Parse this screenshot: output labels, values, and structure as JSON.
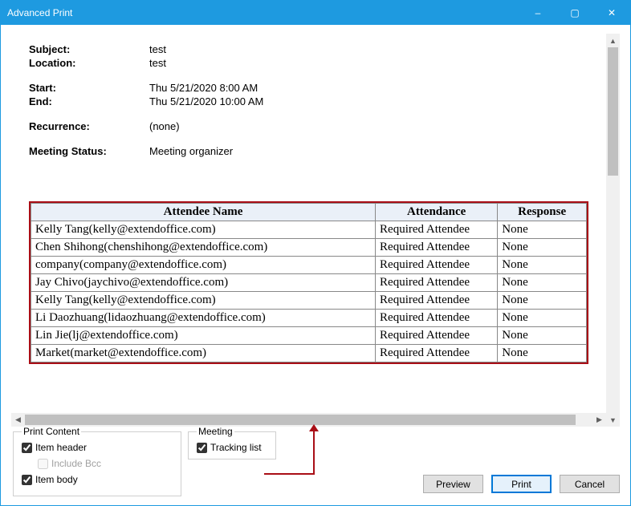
{
  "window": {
    "title": "Advanced Print"
  },
  "meta": {
    "subject_label": "Subject:",
    "subject_value": "test",
    "location_label": "Location:",
    "location_value": "test",
    "start_label": "Start:",
    "start_value": "Thu 5/21/2020 8:00 AM",
    "end_label": "End:",
    "end_value": "Thu 5/21/2020 10:00 AM",
    "recurrence_label": "Recurrence:",
    "recurrence_value": "(none)",
    "status_label": "Meeting Status:",
    "status_value": "Meeting organizer"
  },
  "tracking": {
    "col_name": "Attendee Name",
    "col_attendance": "Attendance",
    "col_response": "Response",
    "rows": [
      {
        "name": "Kelly Tang(kelly@extendoffice.com)",
        "attendance": "Required Attendee",
        "response": "None"
      },
      {
        "name": "Chen Shihong(chenshihong@extendoffice.com)",
        "attendance": "Required Attendee",
        "response": "None"
      },
      {
        "name": "company(company@extendoffice.com)",
        "attendance": "Required Attendee",
        "response": "None"
      },
      {
        "name": "Jay Chivo(jaychivo@extendoffice.com)",
        "attendance": "Required Attendee",
        "response": "None"
      },
      {
        "name": "Kelly Tang(kelly@extendoffice.com)",
        "attendance": "Required Attendee",
        "response": "None"
      },
      {
        "name": "Li Daozhuang(lidaozhuang@extendoffice.com)",
        "attendance": "Required Attendee",
        "response": "None"
      },
      {
        "name": "Lin Jie(lj@extendoffice.com)",
        "attendance": "Required Attendee",
        "response": "None"
      },
      {
        "name": "Market(market@extendoffice.com)",
        "attendance": "Required Attendee",
        "response": "None"
      }
    ]
  },
  "print_content": {
    "legend": "Print Content",
    "item_header": "Item header",
    "include_bcc": "Include Bcc",
    "item_body": "Item body"
  },
  "meeting_group": {
    "legend": "Meeting",
    "tracking_list": "Tracking list"
  },
  "buttons": {
    "preview": "Preview",
    "print": "Print",
    "cancel": "Cancel"
  },
  "glyphs": {
    "minimize": "–",
    "maximize": "▢",
    "close": "✕",
    "up": "▲",
    "down": "▼",
    "left": "◀",
    "right": "▶"
  }
}
